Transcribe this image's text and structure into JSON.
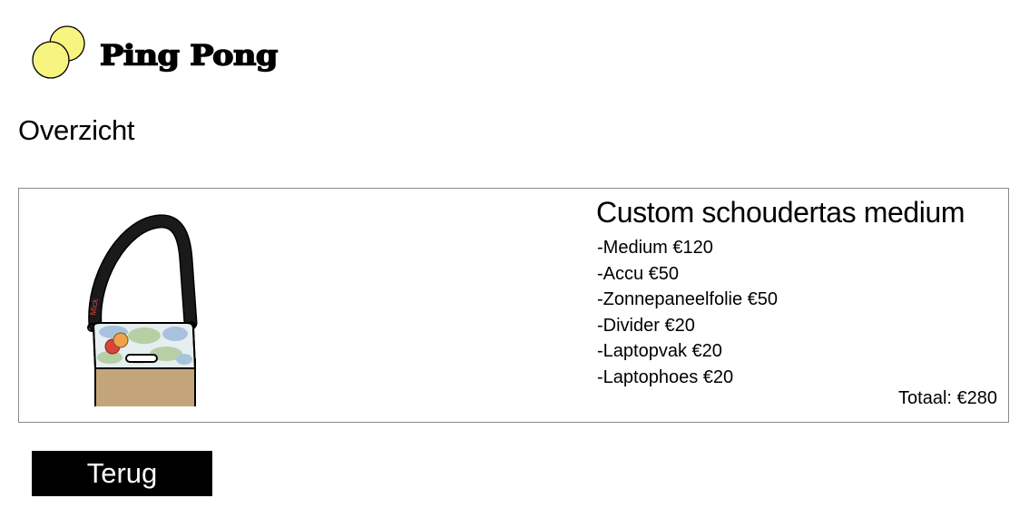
{
  "brand": {
    "name": "Ping Pong",
    "logo_icon": "two-ping-pong-balls-icon",
    "logo_color": "#f7f57f"
  },
  "page": {
    "title": "Overzicht"
  },
  "order": {
    "product_title": "Custom schoudertas medium",
    "product_image_icon": "shoulder-bag-image",
    "strap_text": "Mick",
    "options": [
      "-Medium €120",
      "-Accu €50",
      "-Zonnepaneelfolie €50",
      "-Divider €20",
      "-Laptopvak €20",
      "-Laptophoes €20"
    ],
    "total": "Totaal: €280"
  },
  "actions": {
    "back_label": "Terug"
  },
  "colors": {
    "bag_body": "#c4a57b",
    "accent_red": "#d9443a",
    "accent_orange": "#f0a24a",
    "button_bg": "#000000",
    "button_text": "#ffffff"
  }
}
